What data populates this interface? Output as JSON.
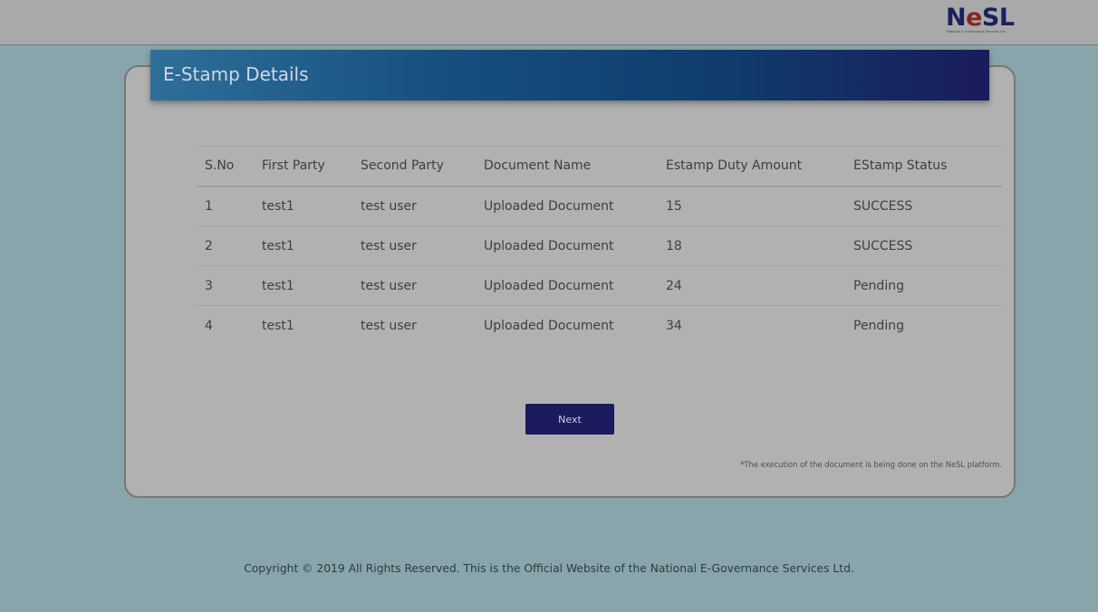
{
  "logo": {
    "wordmark_start": "N",
    "wordmark_e": "e",
    "wordmark_end": "SL",
    "tagline": "National E-Governance Services Ltd."
  },
  "card": {
    "title": "E-Stamp Details"
  },
  "table": {
    "headers": [
      "S.No",
      "First Party",
      "Second Party",
      "Document Name",
      "Estamp Duty Amount",
      "EStamp Status"
    ],
    "rows": [
      [
        "1",
        "test1",
        "test user",
        "Uploaded Document",
        "15",
        "SUCCESS"
      ],
      [
        "2",
        "test1",
        "test user",
        "Uploaded Document",
        "18",
        "SUCCESS"
      ],
      [
        "3",
        "test1",
        "test user",
        "Uploaded Document",
        "24",
        "Pending"
      ],
      [
        "4",
        "test1",
        "test user",
        "Uploaded Document",
        "34",
        "Pending"
      ]
    ]
  },
  "actions": {
    "next_label": "Next"
  },
  "note": {
    "star": "*",
    "text": "The execution of the document is being done on the NeSL platform."
  },
  "footer": {
    "copyright": "Copyright © 2019 All Rights Reserved. This is the Official Website of the National E-Governance Services Ltd."
  },
  "colors": {
    "brand_navy": "#1b1a5c",
    "brand_red": "#8a2424",
    "header_gradient_start": "#2e6f9a",
    "header_gradient_end": "#1b1b5c"
  }
}
